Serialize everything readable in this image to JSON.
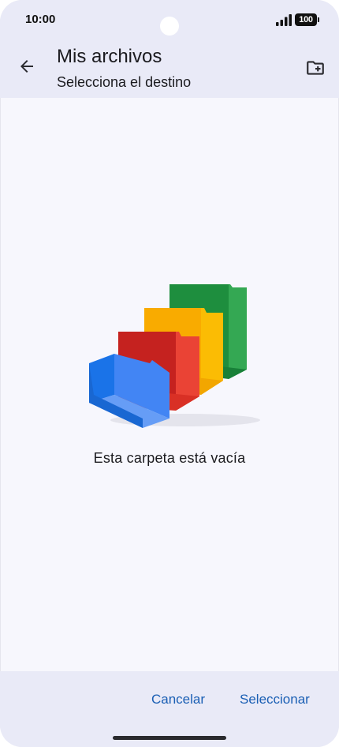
{
  "status_bar": {
    "time": "10:00",
    "battery": "100",
    "signal_icon": "signal-icon",
    "battery_icon": "battery-icon"
  },
  "app_bar": {
    "title": "Mis archivos",
    "subtitle": "Selecciona el destino",
    "back_icon": "arrow-back-icon",
    "new_folder_icon": "create-new-folder-icon"
  },
  "empty_state": {
    "illustration": "empty-folders-illustration",
    "message": "Esta carpeta está vacía"
  },
  "actions": {
    "cancel_label": "Cancelar",
    "select_label": "Seleccionar"
  },
  "colors": {
    "accent": "#1a5fb4",
    "bar_background": "#e9eaf7",
    "page_background": "#f7f7fd"
  }
}
